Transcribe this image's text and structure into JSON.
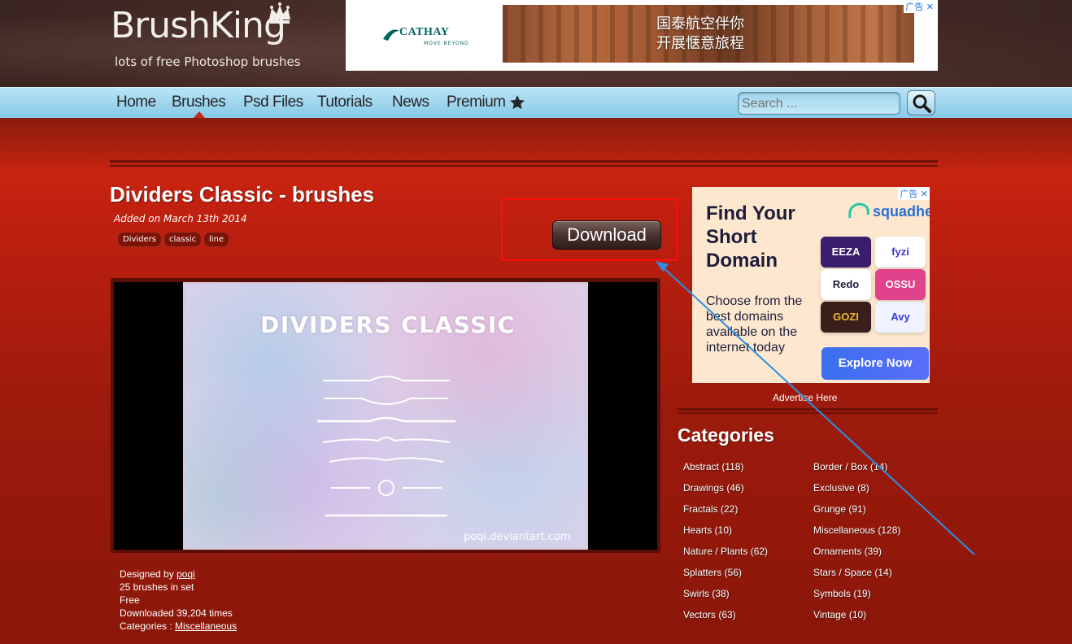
{
  "site": {
    "logo_title": "BrushKing",
    "logo_subtitle": "lots of free Photoshop brushes"
  },
  "top_ad": {
    "brand": "CATHAY",
    "brand_tagline": "MOVE BEYOND",
    "line1": "国泰航空伴你",
    "line2": "开展惬意旅程",
    "badge": "广告 ✕"
  },
  "nav": {
    "items": [
      {
        "label": "Home"
      },
      {
        "label": "Brushes"
      },
      {
        "label": "Psd Files"
      },
      {
        "label": "Tutorials"
      },
      {
        "label": "News"
      },
      {
        "label": "Premium"
      }
    ],
    "active": "Brushes",
    "search_placeholder": "Search ...",
    "star_icon": "star-icon",
    "search_icon": "magnifier-icon"
  },
  "brush": {
    "title": "Dividers Classic - brushes",
    "added_on": "Added on March 13th 2014",
    "tags": [
      "Dividers",
      "classic",
      "line"
    ],
    "download_label": "Download",
    "preview_title": "DIVIDERS CLASSIC",
    "preview_watermark": "poqi.deviantart.com",
    "designed_by_label": "Designed by",
    "designer": "poqi",
    "count_text": "25 brushes in set",
    "license": "Free",
    "downloads_text": "Downloaded 39,204 times",
    "categories_label": "Categories :",
    "category": "Miscellaneous"
  },
  "side_ad": {
    "headline": "Find Your Short Domain",
    "body": "Choose from the best domains available on the internet today",
    "brand": "squadhelp",
    "tiles": [
      "EEZA",
      "fyzi",
      "Redo",
      "OSSU",
      "GOZI",
      "Avy"
    ],
    "cta": "Explore Now",
    "badge": "广告 ✕"
  },
  "sidebar": {
    "advertise_label": "Advertise Here",
    "categories_heading": "Categories",
    "categories_left": [
      "Abstract (118)",
      "Drawings (46)",
      "Fractals (22)",
      "Hearts (10)",
      "Nature / Plants (62)",
      "Splatters (56)",
      "Swirls (38)",
      "Vectors (63)"
    ],
    "categories_right": [
      "Border / Box (14)",
      "Exclusive (8)",
      "Grunge (91)",
      "Miscellaneous (128)",
      "Ornaments (39)",
      "Stars / Space (14)",
      "Symbols (19)",
      "Vintage (10)"
    ]
  },
  "colors": {
    "nav_bg": "#87c9e7",
    "content_red": "#c02010",
    "highlight": "#ff0d0d",
    "annotation_arrow": "#2e8fe0"
  }
}
